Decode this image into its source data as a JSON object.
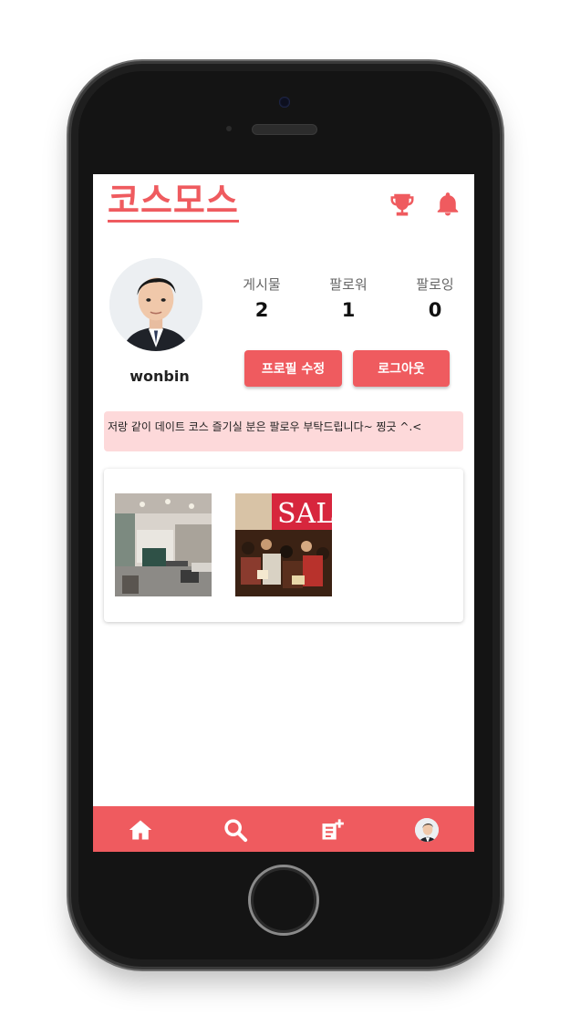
{
  "app": {
    "logo": "코스모스"
  },
  "colors": {
    "accent": "#ef5b5f",
    "bio_bg": "#fdd9da"
  },
  "header": {
    "icons": [
      "trophy-icon",
      "bell-icon"
    ]
  },
  "profile": {
    "username": "wonbin",
    "stats": [
      {
        "label": "게시물",
        "value": "2"
      },
      {
        "label": "팔로워",
        "value": "1"
      },
      {
        "label": "팔로잉",
        "value": "0"
      }
    ],
    "edit_button": "프로필 수정",
    "logout_button": "로그아웃",
    "bio": "저랑 같이 데이트 코스 즐기실 분은 팔로우 부탁드립니다~ 찡긋 ^.<"
  },
  "posts": [
    {
      "image": "cafe-interior-photo"
    },
    {
      "image": "sale-store-crowd-photo",
      "text": "SAL"
    }
  ],
  "nav": {
    "items": [
      "home-icon",
      "search-icon",
      "new-post-icon",
      "profile-avatar"
    ]
  }
}
